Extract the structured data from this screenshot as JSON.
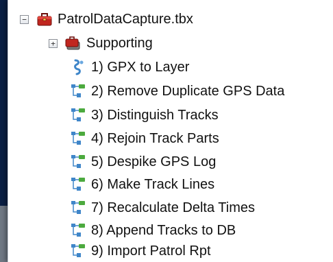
{
  "tree": {
    "root": {
      "expander": "−",
      "label": "PatrolDataCapture.tbx"
    },
    "supporting": {
      "expander": "+",
      "label": "Supporting"
    },
    "items": [
      {
        "label": "1) GPX to Layer",
        "icon": "script-tool-icon"
      },
      {
        "label": "2) Remove Duplicate GPS Data",
        "icon": "model-tool-icon"
      },
      {
        "label": "3) Distinguish Tracks",
        "icon": "model-tool-icon"
      },
      {
        "label": "4) Rejoin Track Parts",
        "icon": "model-tool-icon"
      },
      {
        "label": "5) Despike GPS Log",
        "icon": "model-tool-icon"
      },
      {
        "label": "6) Make Track Lines",
        "icon": "model-tool-icon"
      },
      {
        "label": "7) Recalculate Delta Times",
        "icon": "model-tool-icon"
      },
      {
        "label": "8) Append Tracks to DB",
        "icon": "model-tool-icon"
      },
      {
        "label": "9) Import Patrol Rpt",
        "icon": "model-tool-icon"
      }
    ]
  },
  "colors": {
    "background": "#0a1f44",
    "panel": "#ffffff",
    "toolbox_red": "#c0261f",
    "model_blue": "#3f86c9",
    "model_green": "#4caa3e"
  }
}
